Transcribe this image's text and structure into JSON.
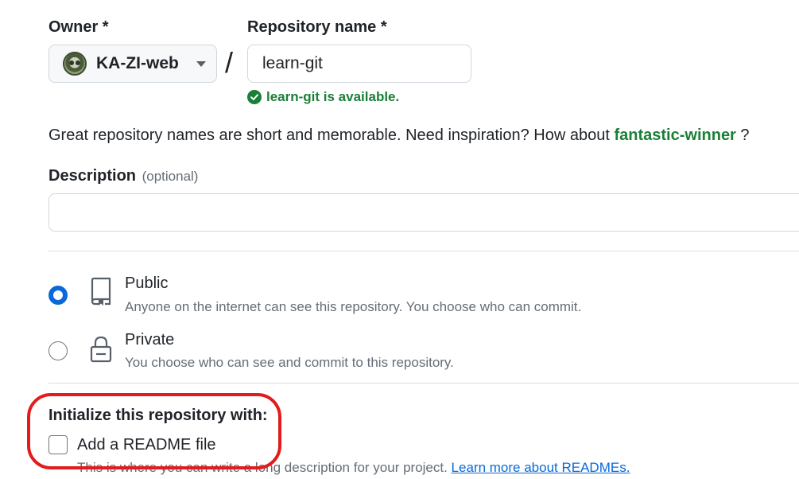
{
  "owner": {
    "label": "Owner *",
    "value": "KA-ZI-web",
    "avatar": "owner-avatar",
    "dropdown_icon": "caret-down-icon"
  },
  "separator": "/",
  "repository": {
    "label": "Repository name *",
    "value": "learn-git",
    "availability_text": "learn-git is available.",
    "availability_icon": "check-circle-icon",
    "availability_color": "#1a7f37"
  },
  "inspiration": {
    "text": "Great repository names are short and memorable. Need inspiration? How about ",
    "suggestion": "fantastic-winner",
    "suffix": " ?"
  },
  "description": {
    "label": "Description",
    "optional": "(optional)",
    "value": ""
  },
  "visibility": {
    "selected": "public",
    "options": [
      {
        "key": "public",
        "title": "Public",
        "description": "Anyone on the internet can see this repository. You choose who can commit.",
        "icon": "repo-icon"
      },
      {
        "key": "private",
        "title": "Private",
        "description": "You choose who can see and commit to this repository.",
        "icon": "lock-icon"
      }
    ]
  },
  "initialize": {
    "heading": "Initialize this repository with:",
    "readme": {
      "label": "Add a README file",
      "checked": false,
      "hint": "This is where you can write a long description for your project. ",
      "link": "Learn more about READMEs."
    }
  },
  "colors": {
    "accent": "#0969da",
    "success": "#1a7f37",
    "annotation": "#e31b1b"
  }
}
